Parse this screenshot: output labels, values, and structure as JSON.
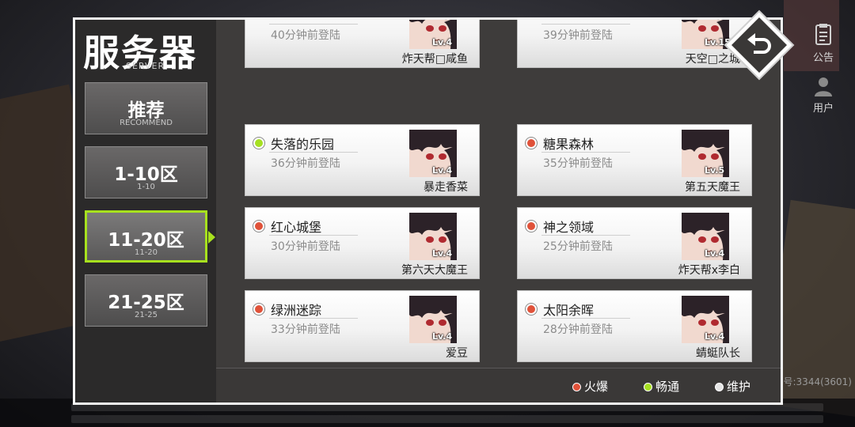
{
  "panel": {
    "title": "服务器",
    "title_sub": "SERVER"
  },
  "sidebar": {
    "tabs": [
      {
        "label": "推荐",
        "sub": "RECOMMEND",
        "active": false
      },
      {
        "label": "1-10区",
        "sub": "1-10",
        "active": false
      },
      {
        "label": "11-20区",
        "sub": "11-20",
        "active": true
      },
      {
        "label": "21-25区",
        "sub": "21-25",
        "active": false
      }
    ]
  },
  "servers": [
    {
      "name": "",
      "time": "40分钟前登陆",
      "level": "Lv.4",
      "character": "炸天帮□咸鱼",
      "status": "hot"
    },
    {
      "name": "",
      "time": "39分钟前登陆",
      "level": "Lv.15",
      "character": "天空□之城",
      "status": "hot"
    },
    {
      "name": "失落的乐园",
      "time": "36分钟前登陆",
      "level": "Lv.4",
      "character": "暴走香菜",
      "status": "smooth"
    },
    {
      "name": "糖果森林",
      "time": "35分钟前登陆",
      "level": "Lv.5",
      "character": "第五天魔王",
      "status": "hot"
    },
    {
      "name": "红心城堡",
      "time": "30分钟前登陆",
      "level": "Lv.4",
      "character": "第六天大魔王",
      "status": "hot"
    },
    {
      "name": "神之领域",
      "time": "25分钟前登陆",
      "level": "Lv.4",
      "character": "炸天帮x李白",
      "status": "hot"
    },
    {
      "name": "绿洲迷踪",
      "time": "33分钟前登陆",
      "level": "Lv.4",
      "character": "爱豆",
      "status": "hot"
    },
    {
      "name": "太阳余晖",
      "time": "28分钟前登陆",
      "level": "Lv.4",
      "character": "蜻蜓队长",
      "status": "hot"
    }
  ],
  "legend": {
    "hot_label": "火爆",
    "smooth_label": "畅通",
    "maintenance_label": "维护"
  },
  "status_colors": {
    "hot": "#e0523a",
    "smooth": "#a6e022",
    "maintenance": "#e6e6e6"
  },
  "hud": {
    "notice_label": "公告",
    "user_label": "用户",
    "version_text": "号:3344(3601)"
  },
  "icons": {
    "back": "back-arrow-icon",
    "notice": "notice-icon",
    "user": "user-icon"
  }
}
